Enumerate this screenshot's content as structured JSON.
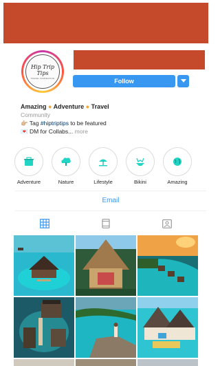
{
  "profile": {
    "logo_text": "Hip Trip Tips",
    "logo_subtext": "TRAVEL INSPIRATION",
    "follow_label": "Follow",
    "bio": {
      "title_parts": [
        "Amazing",
        "Adventure",
        "Travel"
      ],
      "category": "Community",
      "line1_prefix": "👉🏼 Tag ",
      "line1_tag": "#hiptriptips",
      "line1_suffix": " to be featured",
      "line2": "💌 DM for Collabs...",
      "more": "more"
    }
  },
  "highlights": [
    {
      "label": "Adventure",
      "icon": "luggage-icon"
    },
    {
      "label": "Nature",
      "icon": "tree-icon"
    },
    {
      "label": "Lifestyle",
      "icon": "beach-icon"
    },
    {
      "label": "Bikini",
      "icon": "bikini-icon"
    },
    {
      "label": "Amazing",
      "icon": "globe-icon"
    }
  ],
  "contact": {
    "email_label": "Email"
  },
  "tabs": [
    {
      "name": "grid",
      "icon": "grid-icon",
      "active": true
    },
    {
      "name": "feed",
      "icon": "feed-icon",
      "active": false
    },
    {
      "name": "tagged",
      "icon": "tagged-icon",
      "active": false
    }
  ],
  "colors": {
    "accent": "#3897f0",
    "highlight_icon": "#21d4c4",
    "redaction": "#c54a2c",
    "title_dot": "#f3a53a"
  }
}
